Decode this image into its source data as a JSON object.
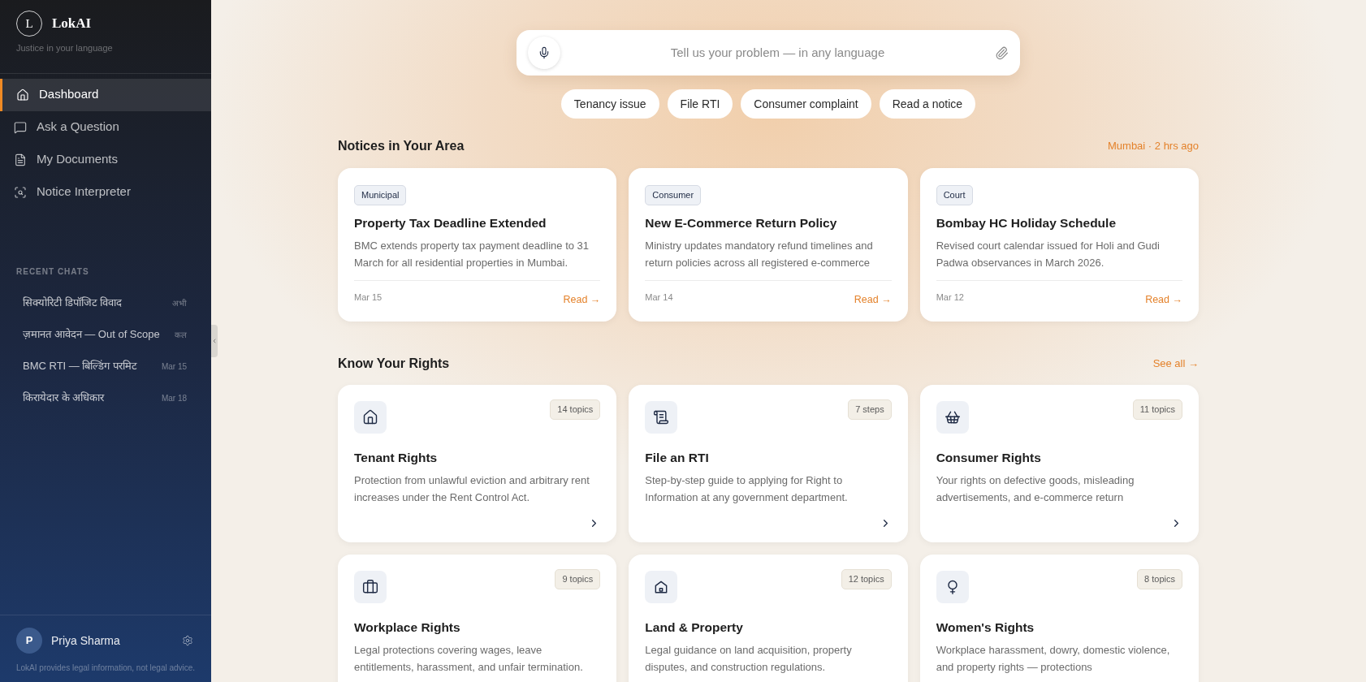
{
  "brand": {
    "logo_letter": "L",
    "name": "LokAI",
    "tagline": "Justice in your language"
  },
  "nav": [
    {
      "label": "Dashboard",
      "selected": true
    },
    {
      "label": "Ask a Question",
      "selected": false
    },
    {
      "label": "My Documents",
      "selected": false
    },
    {
      "label": "Notice Interpreter",
      "selected": false
    }
  ],
  "recent_chats": {
    "heading": "RECENT CHATS",
    "items": [
      {
        "title": "सिक्योरिटी डिपॉजिट विवाद",
        "time": "अभी"
      },
      {
        "title": "ज़मानत आवेदन — Out of Scope",
        "time": "कल"
      },
      {
        "title": "BMC RTI — बिल्डिंग परमिट",
        "time": "Mar 15"
      },
      {
        "title": "किरायेदार के अधिकार",
        "time": "Mar 18"
      }
    ]
  },
  "user": {
    "initial": "P",
    "name": "Priya Sharma"
  },
  "disclaimer": "LokAI provides legal information, not legal advice.",
  "search": {
    "placeholder": "Tell us your problem — in any language"
  },
  "chips": [
    "Tenancy issue",
    "File RTI",
    "Consumer complaint",
    "Read a notice"
  ],
  "notices": {
    "heading": "Notices in Your Area",
    "meta": "Mumbai · 2 hrs ago",
    "cards": [
      {
        "tag": "Municipal",
        "title": "Property Tax Deadline Extended",
        "description": "BMC extends property tax payment deadline to 31 March for all residential properties in Mumbai.",
        "date": "Mar 15",
        "link": "Read →"
      },
      {
        "tag": "Consumer",
        "title": "New E-Commerce Return Policy",
        "description": "Ministry updates mandatory refund timelines and return policies across all registered e-commerce",
        "date": "Mar 14",
        "link": "Read →"
      },
      {
        "tag": "Court",
        "title": "Bombay HC Holiday Schedule",
        "description": "Revised court calendar issued for Holi and Gudi Padwa observances in March 2026.",
        "date": "Mar 12",
        "link": "Read →"
      }
    ]
  },
  "rights": {
    "heading": "Know Your Rights",
    "link": "See all →",
    "cards": [
      {
        "badge": "14 topics",
        "title": "Tenant Rights",
        "description": "Protection from unlawful eviction and arbitrary rent increases under the Rent Control Act.",
        "arrow": true
      },
      {
        "badge": "7 steps",
        "title": "File an RTI",
        "description": "Step-by-step guide to applying for Right to Information at any government department.",
        "arrow": true
      },
      {
        "badge": "11 topics",
        "title": "Consumer Rights",
        "description": "Your rights on defective goods, misleading advertisements, and e-commerce return",
        "arrow": true
      },
      {
        "badge": "9 topics",
        "title": "Workplace Rights",
        "description": "Legal protections covering wages, leave entitlements, harassment, and unfair termination."
      },
      {
        "badge": "12 topics",
        "title": "Land & Property",
        "description": "Legal guidance on land acquisition, property disputes, and construction regulations."
      },
      {
        "badge": "8 topics",
        "title": "Women's Rights",
        "description": "Workplace harassment, dowry, domestic violence, and property rights — protections"
      }
    ]
  }
}
